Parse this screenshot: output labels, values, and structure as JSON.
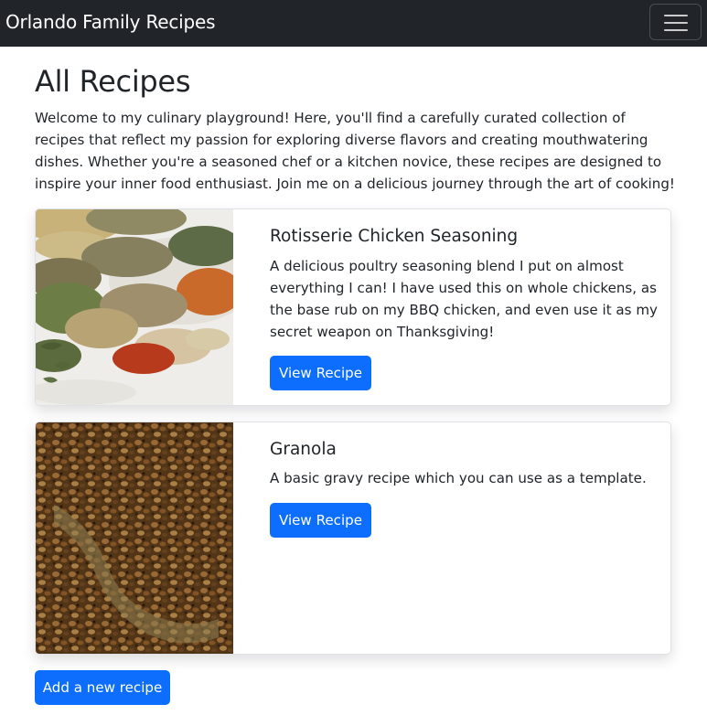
{
  "navbar": {
    "brand": "Orlando Family Recipes",
    "toggle_icon": "hamburger-menu-icon",
    "background": "#212529"
  },
  "page": {
    "title": "All Recipes",
    "intro": "Welcome to my culinary playground! Here, you'll find a carefully curated collection of recipes that reflect my passion for exploring diverse flavors and creating mouthwatering dishes. Whether you're a seasoned chef or a kitchen novice, these recipes are designed to inspire your inner food enthusiast. Join me on a delicious journey through the art of cooking!"
  },
  "recipes": [
    {
      "title": "Rotisserie Chicken Seasoning",
      "description": "A delicious poultry seasoning blend I put on almost everything I can! I have used this on whole chickens, as the base rub on my BBQ chicken, and even use it as my secret weapon on Thanksgiving!",
      "button_label": "View Recipe",
      "image": "spices-photo"
    },
    {
      "title": "Granola",
      "description": "A basic gravy recipe which you can use as a template.",
      "button_label": "View Recipe",
      "image": "granola-photo"
    }
  ],
  "add_button_label": "Add a new recipe",
  "colors": {
    "primary": "#0d6efd",
    "text": "#212529"
  }
}
